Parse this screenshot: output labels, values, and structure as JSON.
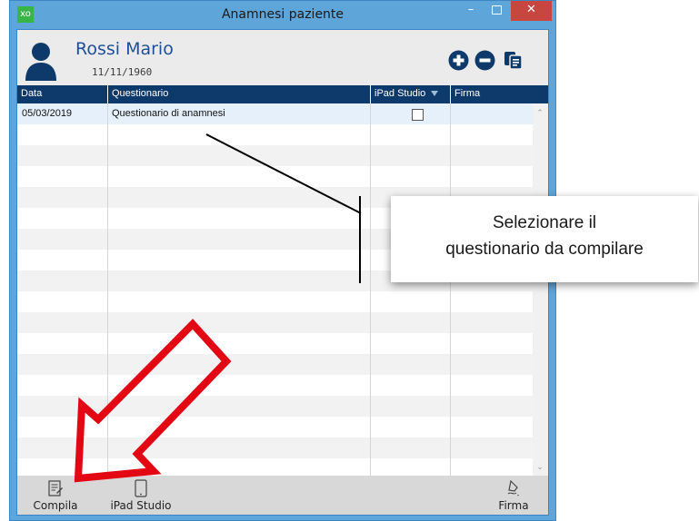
{
  "window": {
    "title": "Anamnesi paziente",
    "app_icon": "xo",
    "minimize_label": "–",
    "close_label": "✕"
  },
  "patient": {
    "name": "Rossi Mario",
    "dob": "11/11/1960"
  },
  "header_actions": [
    {
      "name": "add-icon",
      "glyph": "plus"
    },
    {
      "name": "remove-icon",
      "glyph": "minus"
    },
    {
      "name": "documents-icon",
      "glyph": "copy"
    }
  ],
  "table": {
    "columns": [
      "Data",
      "Questionario",
      "iPad Studio",
      "Firma"
    ],
    "rows": [
      {
        "data": "05/03/2019",
        "questionario": "Questionario di anamnesi",
        "ipad_studio": false,
        "firma": ""
      }
    ]
  },
  "bottom_bar": {
    "compila_label": "Compila",
    "ipad_label": "iPad Studio",
    "firma_label": "Firma"
  },
  "callout": {
    "line1": "Selezionare il",
    "line2": "questionario da compilare"
  },
  "colors": {
    "title_bar": "#5ea5da",
    "table_header": "#0e3a6b",
    "selected_row": "#e6f0fa",
    "stripe": "#f2f2f2",
    "arrow": "#e30613",
    "close_button": "#c7463f",
    "patient_name": "#1f4f9a"
  }
}
